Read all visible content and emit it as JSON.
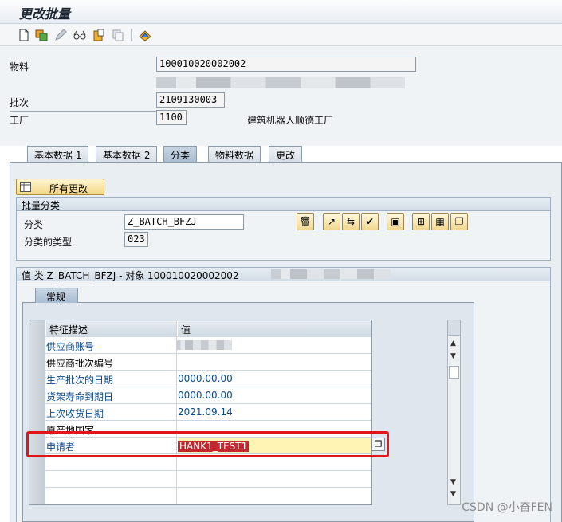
{
  "window": {
    "title": "更改批量"
  },
  "toolbar": {
    "icons": [
      "new-document-icon",
      "change-icon",
      "edit-pencil-icon",
      "glasses-display-icon",
      "clipboard-icon",
      "copy-icon",
      "classification-icon"
    ]
  },
  "header": {
    "material_label": "物料",
    "material_value": "100010020002002",
    "batch_label": "批次",
    "batch_value": "2109130003",
    "plant_label": "工厂",
    "plant_value": "1100",
    "plant_desc": "建筑机器人顺德工厂"
  },
  "tabs": [
    {
      "label": "基本数据 1"
    },
    {
      "label": "基本数据 2"
    },
    {
      "label": "分类"
    },
    {
      "label": "物料数据"
    },
    {
      "label": "更改"
    }
  ],
  "active_tab": 2,
  "main": {
    "all_changes_button": "所有更改",
    "batch_class_header": "批量分类",
    "class_label": "分类",
    "class_value": "Z_BATCH_BFZJ",
    "class_type_label": "分类的类型",
    "class_type_value": "023",
    "values_header": "值 类 Z_BATCH_BFZJ - 对象 100010020002002",
    "inner_tab": "常规"
  },
  "table": {
    "headers": [
      "特征描述",
      "值"
    ],
    "rows": [
      {
        "desc": "供应商账号",
        "value": "",
        "link": true
      },
      {
        "desc": "供应商批次编号",
        "value": "",
        "link": false
      },
      {
        "desc": "生产批次的日期",
        "value": "0000.00.00",
        "link": true
      },
      {
        "desc": "货架寿命到期日",
        "value": "0000.00.00",
        "link": true
      },
      {
        "desc": "上次收货日期",
        "value": "2021.09.14",
        "link": true
      },
      {
        "desc": "原产地国家",
        "value": "",
        "link": false
      },
      {
        "desc": "申请者",
        "value": "HANK1_TEST1",
        "link": true
      }
    ]
  },
  "watermark": "CSDN @小奋FEN"
}
